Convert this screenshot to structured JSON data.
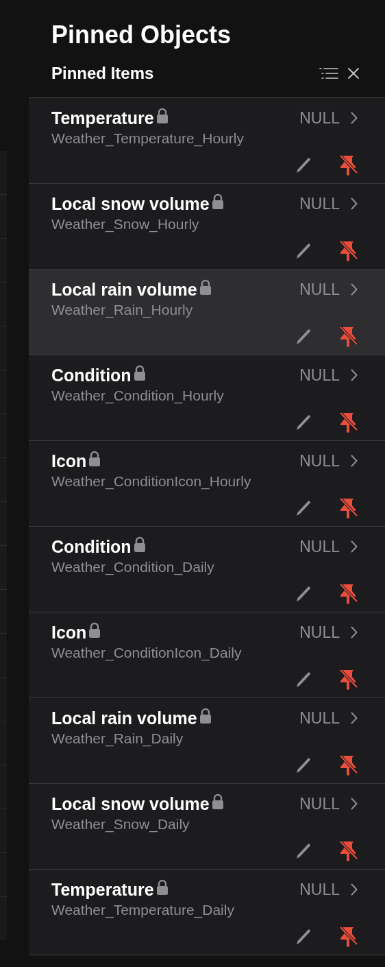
{
  "panel": {
    "title": "Pinned Objects",
    "subtitle": "Pinned Items"
  },
  "items": [
    {
      "name": "Temperature",
      "item": "Weather_Temperature_Hourly",
      "value": "NULL",
      "locked": true,
      "selected": false
    },
    {
      "name": "Local snow volume",
      "item": "Weather_Snow_Hourly",
      "value": "NULL",
      "locked": true,
      "selected": false
    },
    {
      "name": "Local rain volume",
      "item": "Weather_Rain_Hourly",
      "value": "NULL",
      "locked": true,
      "selected": true
    },
    {
      "name": "Condition",
      "item": "Weather_Condition_Hourly",
      "value": "NULL",
      "locked": true,
      "selected": false
    },
    {
      "name": "Icon",
      "item": "Weather_ConditionIcon_Hourly",
      "value": "NULL",
      "locked": true,
      "selected": false
    },
    {
      "name": "Condition",
      "item": "Weather_Condition_Daily",
      "value": "NULL",
      "locked": true,
      "selected": false
    },
    {
      "name": "Icon",
      "item": "Weather_ConditionIcon_Daily",
      "value": "NULL",
      "locked": true,
      "selected": false
    },
    {
      "name": "Local rain volume",
      "item": "Weather_Rain_Daily",
      "value": "NULL",
      "locked": true,
      "selected": false
    },
    {
      "name": "Local snow volume",
      "item": "Weather_Snow_Daily",
      "value": "NULL",
      "locked": true,
      "selected": false
    },
    {
      "name": "Temperature",
      "item": "Weather_Temperature_Daily",
      "value": "NULL",
      "locked": true,
      "selected": false
    }
  ]
}
